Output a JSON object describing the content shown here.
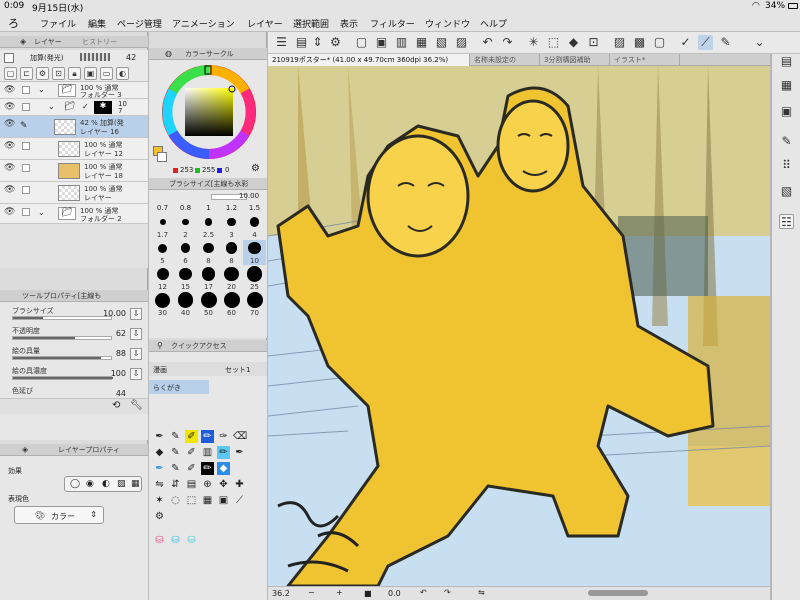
{
  "status": {
    "time": "0:09",
    "date": "9月15日(水)",
    "wifi_icon": "wifi-icon",
    "battery": "34%"
  },
  "menu": [
    "ファイル",
    "編集",
    "ページ管理",
    "アニメーション",
    "レイヤー",
    "選択範囲",
    "表示",
    "フィルター",
    "ウィンドウ",
    "ヘルプ"
  ],
  "doc_tabs": [
    "210919ポスター* (41.00 x 49.70cm 360dpi 36.2%)",
    "名称未設定の",
    "3分割構図補助",
    "イラスト*"
  ],
  "layer_panel": {
    "tabs": [
      "レイヤー",
      "ヒストリー"
    ],
    "blend_mode": "加算(発光)",
    "opacity": "42",
    "layers": [
      {
        "line1": "100 % 通常",
        "line2": "フォルダー 3"
      },
      {
        "line1": "10",
        "line2": "7"
      },
      {
        "line1": "42 % 加算(発",
        "line2": "レイヤー 16"
      },
      {
        "line1": "100 % 通常",
        "line2": "レイヤー 12"
      },
      {
        "line1": "100 % 通常",
        "line2": "レイヤー 18"
      },
      {
        "line1": "100 % 通常",
        "line2": "レイヤー"
      },
      {
        "line1": "100 % 通常",
        "line2": "フォルダー 2"
      }
    ]
  },
  "tool_property": {
    "title": "ツールプロパティ[主線も",
    "rows": [
      {
        "label": "ブラシサイズ",
        "value": "10.00"
      },
      {
        "label": "不透明度",
        "value": "62"
      },
      {
        "label": "絵の具量",
        "value": "88"
      },
      {
        "label": "絵の具濃度",
        "value": "100"
      },
      {
        "label": "色延び",
        "value": "44"
      }
    ]
  },
  "layer_property": {
    "title": "レイヤープロパティ",
    "effect_label": "効果",
    "display_color_label": "表現色",
    "display_color_value": "カラー"
  },
  "color_circle": {
    "title": "カラーサークル",
    "r": "253",
    "g": "255",
    "b": "0",
    "main_color": "#f2c230",
    "sub_color": "#ffffff"
  },
  "brush_size": {
    "title": "ブラシサイズ[主線も水彩",
    "current": "10.00",
    "header": [
      "0.7",
      "0.8",
      "1",
      "1.2",
      "1.5"
    ],
    "labels": [
      "1.7",
      "2",
      "2.5",
      "3",
      "4",
      "5",
      "6",
      "8",
      "8",
      "10",
      "12",
      "15",
      "17",
      "20",
      "25",
      "30",
      "40",
      "50",
      "60",
      "70"
    ]
  },
  "quick_access": {
    "title": "クイックアクセス",
    "tabs": [
      "漫画",
      "セット1"
    ],
    "selected": "らくがき"
  },
  "bottom": {
    "zoom": "36.2",
    "angle": "0.0"
  }
}
